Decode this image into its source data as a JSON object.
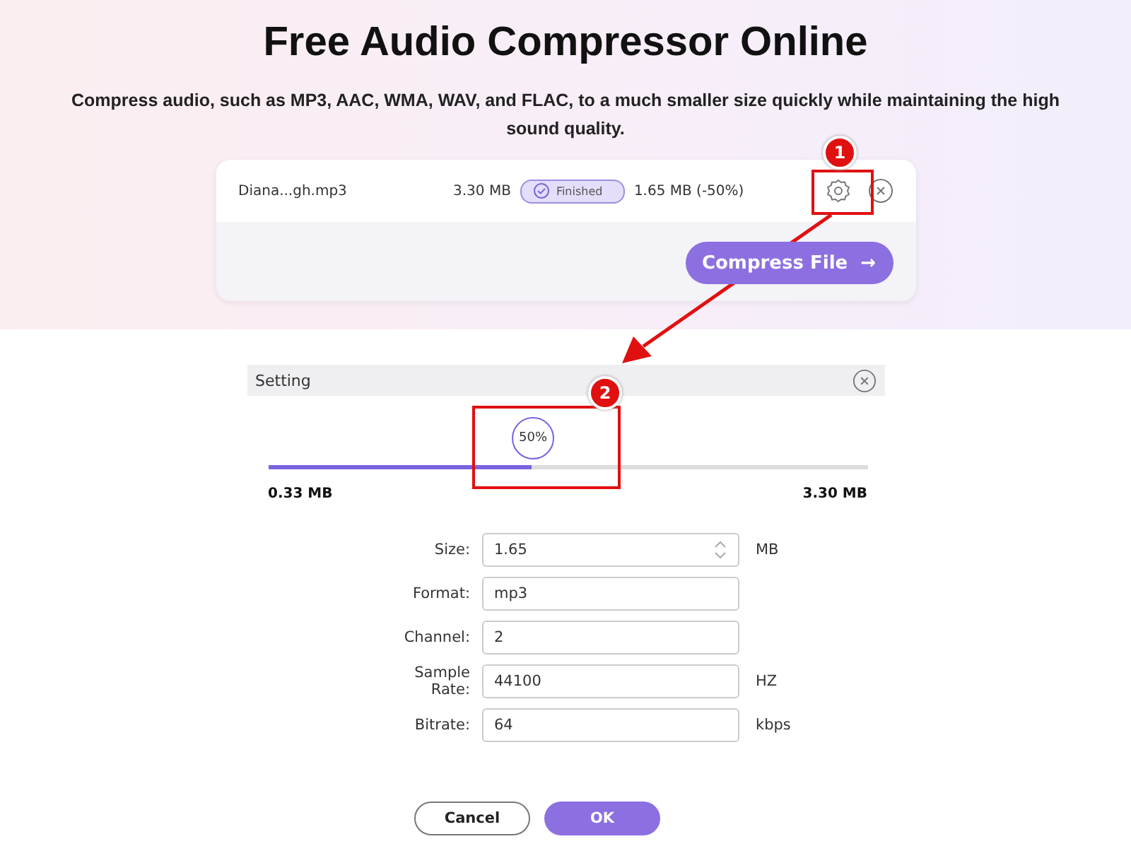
{
  "title": "Free Audio Compressor Online",
  "subtitle": "Compress audio, such as MP3, AAC, WMA, WAV, and FLAC, to a much smaller size quickly while maintaining the high sound quality.",
  "file": {
    "name": "Diana...gh.mp3",
    "original_size": "3.30 MB",
    "status": "Finished",
    "compressed_size": "1.65 MB (-50%)"
  },
  "compress_button": {
    "label": "Compress File",
    "icon": "→"
  },
  "setting": {
    "title": "Setting",
    "slider": {
      "level": 0.44,
      "label": "50%",
      "min_label": "0.33 MB",
      "max_label": "3.30 MB"
    },
    "fields": [
      {
        "label": "Size:",
        "value": "1.65",
        "unit": "MB",
        "kind": "spinner"
      },
      {
        "label": "Format:",
        "value": "mp3",
        "kind": "text"
      },
      {
        "label": "Channel:",
        "value": "2",
        "kind": "text"
      },
      {
        "label": "Sample Rate:",
        "value": "44100",
        "unit": "HZ",
        "kind": "text"
      },
      {
        "label": "Bitrate:",
        "value": "64",
        "unit": "kbps",
        "kind": "text"
      }
    ],
    "buttons": [
      {
        "label": "Cancel",
        "kind": "secondary"
      },
      {
        "label": "OK",
        "kind": "primary"
      }
    ]
  },
  "callouts": [
    {
      "label": "1"
    },
    {
      "label": "2"
    }
  ]
}
